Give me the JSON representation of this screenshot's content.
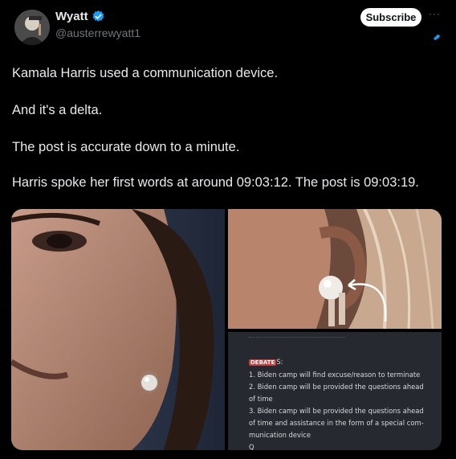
{
  "author": {
    "name": "Wyatt",
    "handle": "@austerrewyatt1",
    "verified": true
  },
  "actions": {
    "subscribe_label": "Subscribe",
    "more_label": "···"
  },
  "tweet": {
    "lines": [
      "Kamala Harris used a communication device.",
      "And it's a delta.",
      "The post is accurate down to a minute.",
      "Harris spoke her first words at around 09:03:12. The post is 09:03:19."
    ]
  },
  "media": {
    "document": {
      "tag": "DEBATE",
      "tag_suffix": "S:",
      "lines": [
        "1. Biden camp will find excuse/reason to terminate",
        "2. Biden camp will be provided the questions ahead",
        "of time",
        "3. Biden camp will be provided the questions ahead",
        "of time and assistance in the form of a special com-",
        "munication device",
        "Q"
      ]
    }
  },
  "colors": {
    "background": "#000000",
    "verified_badge": "#1d9bf0",
    "text_primary": "#e7e9ea",
    "text_secondary": "#71767b"
  }
}
